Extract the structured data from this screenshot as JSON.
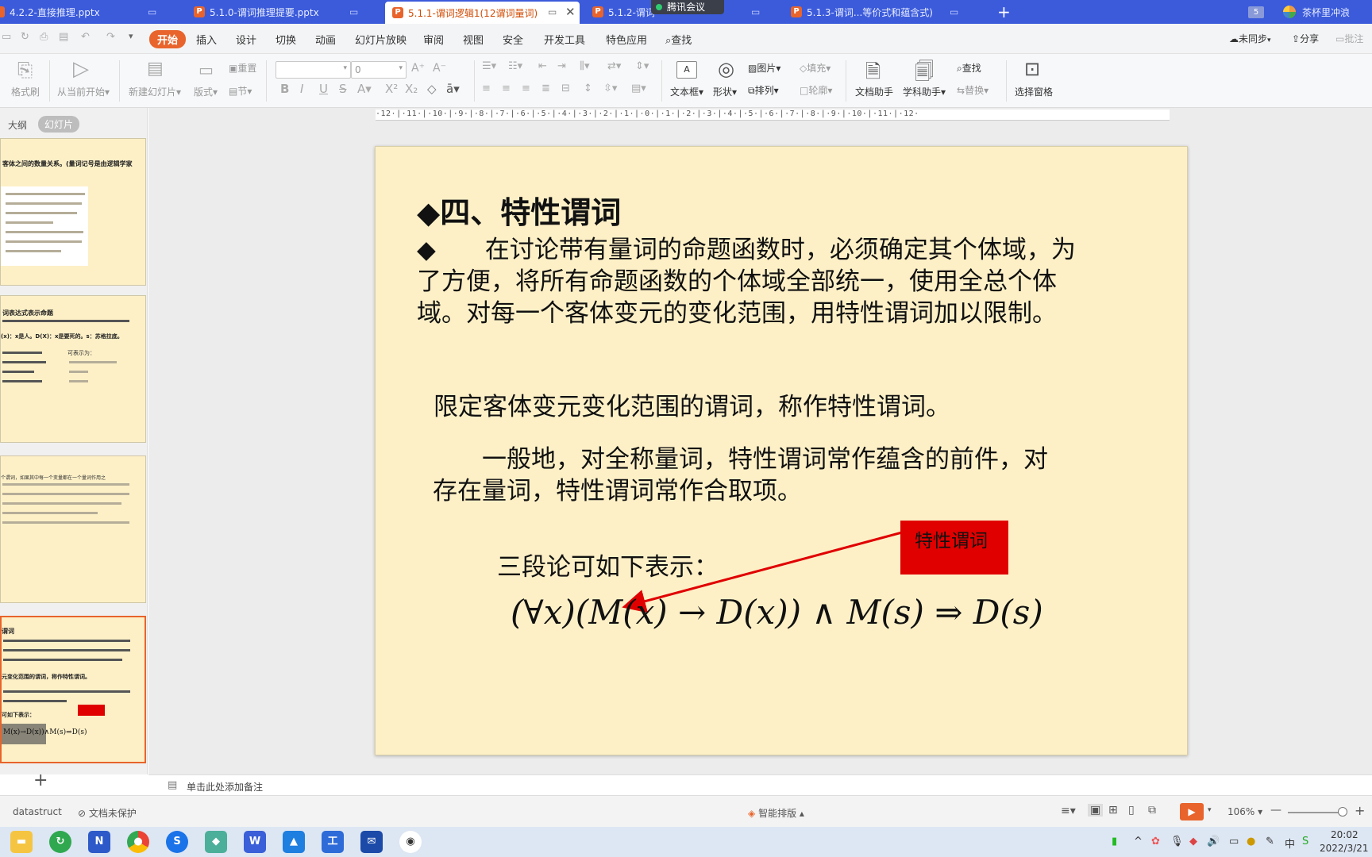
{
  "tabs": [
    {
      "label": "4.2.2-直接推理.pptx",
      "active": false
    },
    {
      "label": "5.1.0-谓词推理提要.pptx",
      "active": false
    },
    {
      "label": "5.1.1-谓词逻辑1(12谓词量词)",
      "active": true
    },
    {
      "label": "5.1.2-谓词",
      "active": false
    },
    {
      "label": "5.1.3-谓词...等价式和蕴含式)",
      "active": false
    }
  ],
  "meeting_label": "腾讯会议",
  "window_badge": "5",
  "user_name": "茶杯里冲浪",
  "menu": {
    "items": [
      "开始",
      "插入",
      "设计",
      "切换",
      "动画",
      "幻灯片放映",
      "审阅",
      "视图",
      "安全",
      "开发工具",
      "特色应用"
    ],
    "search": "查找",
    "sync": "未同步",
    "share": "分享",
    "comment": "批注"
  },
  "ribbon": {
    "format_painter": "格式刷",
    "play_from_current": "从当前开始",
    "new_slide": "新建幻灯片",
    "layout": "版式",
    "reset": "重置",
    "section": "节",
    "font_size": "0",
    "textbox": "文本框",
    "shape": "形状",
    "picture": "图片",
    "fill": "填充",
    "arrange": "排列",
    "outline": "轮廓",
    "doc_assistant": "文档助手",
    "subject_assistant": "学科助手",
    "find": "查找",
    "replace": "替换",
    "selection_pane": "选择窗格"
  },
  "panel_tabs": {
    "outline": "大纲",
    "slides": "幻灯片"
  },
  "thumbnails": {
    "t1": "客体之间的数量关系。(量词记号是由逻辑学家",
    "t2a": "词表达式表示命题",
    "t2b": "(x)：x是人。D(X)：x是要死的。s：苏格拉底。",
    "t2c": "可表示为：",
    "t3": "个谓词，如果其中每一个变量都在一个量词作用之",
    "t4a": "谓词",
    "t4b": "元变化范围的谓词，称作特性谓词。",
    "t4c": "可如下表示：",
    "t4formula": "M(x)→D(x))∧M(s)⇒D(s)"
  },
  "ruler": "·12·|·11·|·10·|·9·|·8·|·7·|·6·|·5·|·4·|·3·|·2·|·1·|·0·|·1·|·2·|·3·|·4·|·5·|·6·|·7·|·8·|·9·|·10·|·11·|·12·",
  "slide": {
    "title": "◆四、特性谓词",
    "para1": [
      "◆　　在讨论带有量词的命题函数时，必须确定其个体域，为",
      "了方便，将所有命题函数的个体域全部统一，使用全总个体",
      "域。对每一个客体变元的变化范围，用特性谓词加以限制。"
    ],
    "definition": "限定客体变元变化范围的谓词，称作特性谓词。",
    "para2": [
      "　　一般地，对全称量词，特性谓词常作蕴含的前件，对",
      "存在量词，特性谓词常作合取项。"
    ],
    "syllogism": "三段论可如下表示：",
    "callout": "特性谓词",
    "formula": "(∀x)(M(x) → D(x)) ∧ M(s) ⇒ D(s)",
    "callout_color": "#e00000"
  },
  "notes_placeholder": "单击此处添加备注",
  "status": {
    "theme": "datastruct",
    "protection": "文档未保护",
    "smart_layout": "智能排版",
    "zoom": "106%"
  },
  "taskbar": {
    "clock_time": "20:02",
    "clock_date": "2022/3/21",
    "ime": "中"
  }
}
